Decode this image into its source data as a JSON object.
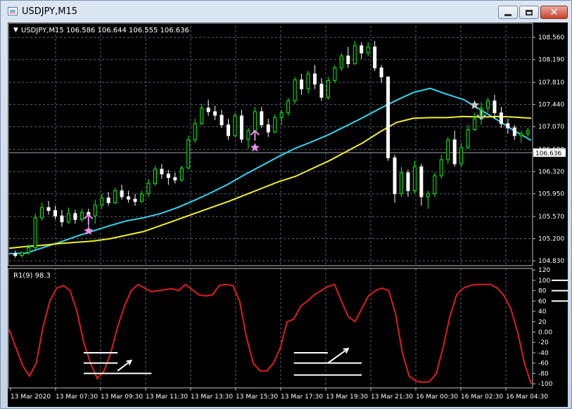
{
  "window": {
    "title": "USDJPY,M15"
  },
  "colors": {
    "background": "#000000",
    "axis": "#c0c0c0",
    "grid": "#5a6573",
    "bull": "#00ff00",
    "bear": "#ffffff",
    "ma_fast": "#2fd7f5",
    "ma_slow": "#f2ef2a",
    "rsi": "#e01c1c",
    "markers": "#e98be8",
    "star_grey": "#c8c8c8"
  },
  "icons": {
    "app": "mt4-chart-window-icon",
    "minimize": "minimize-icon",
    "maximize": "maximize-icon",
    "close": "close-icon"
  },
  "chart_data": [
    {
      "type": "candlestick",
      "title": "USDJPY,M15",
      "ohlc_label": "USDJPY,M15  106.586 106.644 106.555 106.636",
      "current_price_label": "106.636",
      "current_price": 106.636,
      "ylim": [
        104.75,
        108.75
      ],
      "ticks": [
        108.56,
        108.19,
        107.81,
        107.44,
        107.07,
        106.69,
        106.32,
        105.95,
        105.57,
        105.2,
        104.83
      ],
      "tick_labels": [
        "108.560",
        "108.190",
        "107.810",
        "107.440",
        "107.070",
        "106.690",
        "106.320",
        "105.950",
        "105.570",
        "105.200",
        "104.830"
      ],
      "grid": true,
      "series": [
        {
          "name": "ma_fast",
          "values": [
            104.95,
            104.96,
            105.05,
            105.14,
            105.24,
            105.33,
            105.42,
            105.5,
            105.55,
            105.62,
            105.72,
            105.84,
            105.97,
            106.11,
            106.27,
            106.42,
            106.57,
            106.71,
            106.82,
            106.94,
            107.08,
            107.22,
            107.37,
            107.51,
            107.64,
            107.71,
            107.61,
            107.52,
            107.35,
            107.18,
            107.0,
            106.84
          ]
        },
        {
          "name": "ma_slow",
          "values": [
            105.04,
            105.07,
            105.09,
            105.12,
            105.14,
            105.16,
            105.2,
            105.26,
            105.32,
            105.42,
            105.52,
            105.62,
            105.72,
            105.82,
            105.93,
            106.04,
            106.15,
            106.24,
            106.37,
            106.5,
            106.65,
            106.8,
            106.98,
            107.14,
            107.21,
            107.22,
            107.22,
            107.24,
            107.23,
            107.24,
            107.23,
            107.21
          ]
        }
      ],
      "candles": [
        [
          104.95,
          105.0,
          104.88,
          104.92
        ],
        [
          104.92,
          104.98,
          104.88,
          104.97
        ],
        [
          104.97,
          105.1,
          104.93,
          105.05
        ],
        [
          105.05,
          105.62,
          105.02,
          105.55
        ],
        [
          105.55,
          105.8,
          105.5,
          105.72
        ],
        [
          105.72,
          105.83,
          105.6,
          105.67
        ],
        [
          105.67,
          105.75,
          105.52,
          105.58
        ],
        [
          105.58,
          105.68,
          105.4,
          105.48
        ],
        [
          105.48,
          105.72,
          105.45,
          105.62
        ],
        [
          105.62,
          105.68,
          105.45,
          105.52
        ],
        [
          105.52,
          105.7,
          105.48,
          105.64
        ],
        [
          105.64,
          105.7,
          105.4,
          105.58
        ],
        [
          105.58,
          105.85,
          105.45,
          105.76
        ],
        [
          105.76,
          105.95,
          105.7,
          105.88
        ],
        [
          105.88,
          105.98,
          105.75,
          105.8
        ],
        [
          105.8,
          106.05,
          105.78,
          106.0
        ],
        [
          106.0,
          106.1,
          105.85,
          105.9
        ],
        [
          105.9,
          106.0,
          105.8,
          105.86
        ],
        [
          105.86,
          105.95,
          105.75,
          105.82
        ],
        [
          105.82,
          106.0,
          105.8,
          105.95
        ],
        [
          105.95,
          106.2,
          105.9,
          106.12
        ],
        [
          106.12,
          106.42,
          106.08,
          106.36
        ],
        [
          106.36,
          106.45,
          106.2,
          106.28
        ],
        [
          106.28,
          106.35,
          106.1,
          106.22
        ],
        [
          106.22,
          106.3,
          106.12,
          106.18
        ],
        [
          106.18,
          106.42,
          106.15,
          106.38
        ],
        [
          106.38,
          106.92,
          106.35,
          106.85
        ],
        [
          106.85,
          107.2,
          106.8,
          107.12
        ],
        [
          107.12,
          107.45,
          107.1,
          107.38
        ],
        [
          107.38,
          107.52,
          107.25,
          107.32
        ],
        [
          107.32,
          107.42,
          107.18,
          107.26
        ],
        [
          107.26,
          107.35,
          107.05,
          107.1
        ],
        [
          107.1,
          107.2,
          106.85,
          106.92
        ],
        [
          106.92,
          107.3,
          106.9,
          107.25
        ],
        [
          107.25,
          107.35,
          106.8,
          106.86
        ],
        [
          106.86,
          107.05,
          106.7,
          107.0
        ],
        [
          107.0,
          107.4,
          106.95,
          107.32
        ],
        [
          107.32,
          107.4,
          107.05,
          107.1
        ],
        [
          107.1,
          107.2,
          106.9,
          106.98
        ],
        [
          106.98,
          107.28,
          106.96,
          107.22
        ],
        [
          107.22,
          107.35,
          107.1,
          107.3
        ],
        [
          107.3,
          107.55,
          107.25,
          107.5
        ],
        [
          107.5,
          107.9,
          107.45,
          107.85
        ],
        [
          107.85,
          107.95,
          107.6,
          107.7
        ],
        [
          107.7,
          108.0,
          107.62,
          107.95
        ],
        [
          107.95,
          108.1,
          107.7,
          107.78
        ],
        [
          107.78,
          107.88,
          107.5,
          107.56
        ],
        [
          107.56,
          107.9,
          107.52,
          107.84
        ],
        [
          107.84,
          108.1,
          107.8,
          108.05
        ],
        [
          108.05,
          108.3,
          108.0,
          108.25
        ],
        [
          108.25,
          108.4,
          108.05,
          108.12
        ],
        [
          108.12,
          108.5,
          108.1,
          108.42
        ],
        [
          108.42,
          108.48,
          108.2,
          108.3
        ],
        [
          108.3,
          108.48,
          108.25,
          108.4
        ],
        [
          108.4,
          108.5,
          108.0,
          108.05
        ],
        [
          108.05,
          108.1,
          107.8,
          107.9
        ],
        [
          107.9,
          107.0,
          106.5,
          106.55
        ],
        [
          106.55,
          106.6,
          105.8,
          105.95
        ],
        [
          105.95,
          106.4,
          105.9,
          106.3
        ],
        [
          106.3,
          106.35,
          105.9,
          106.0
        ],
        [
          106.0,
          106.5,
          105.95,
          106.4
        ],
        [
          106.4,
          106.45,
          105.75,
          105.9
        ],
        [
          105.9,
          106.0,
          105.7,
          105.95
        ],
        [
          105.95,
          106.3,
          105.9,
          106.25
        ],
        [
          106.25,
          106.6,
          106.2,
          106.52
        ],
        [
          106.52,
          106.9,
          106.45,
          106.85
        ],
        [
          106.85,
          107.0,
          106.4,
          106.45
        ],
        [
          106.45,
          106.8,
          106.4,
          106.72
        ],
        [
          106.72,
          107.1,
          106.7,
          107.02
        ],
        [
          107.02,
          107.3,
          107.0,
          107.2
        ],
        [
          107.2,
          107.48,
          107.1,
          107.38
        ],
        [
          107.38,
          107.55,
          107.3,
          107.5
        ],
        [
          107.5,
          107.6,
          107.2,
          107.3
        ],
        [
          107.3,
          107.4,
          107.05,
          107.12
        ],
        [
          107.12,
          107.2,
          106.95,
          107.05
        ],
        [
          107.05,
          107.1,
          106.85,
          106.92
        ],
        [
          106.92,
          107.0,
          106.8,
          106.95
        ],
        [
          106.95,
          107.05,
          106.9,
          107.0
        ]
      ],
      "markers": [
        {
          "type": "star",
          "color": "pink",
          "index": 11,
          "price": 105.33
        },
        {
          "type": "arrow-up",
          "color": "pink",
          "index": 11,
          "price": 105.52
        },
        {
          "type": "star",
          "color": "pink",
          "index": 36,
          "price": 106.72
        },
        {
          "type": "arrow-up",
          "color": "pink",
          "index": 36,
          "price": 106.92
        },
        {
          "type": "star",
          "color": "grey",
          "index": 69,
          "price": 107.43
        },
        {
          "type": "arrow-down",
          "color": "grey",
          "index": 70,
          "price": 107.28
        }
      ]
    },
    {
      "type": "line",
      "title": "R1(9) 98.3",
      "ylim": [
        -108,
        123
      ],
      "ticks": [
        120,
        100,
        80,
        60,
        40,
        20,
        0.0,
        -20,
        -40,
        -60,
        -80,
        -100
      ],
      "tick_labels": [
        "120",
        "100",
        "80",
        "60",
        "40",
        "20",
        "0.00",
        "-20",
        "-40",
        "-60",
        "-80",
        "-100"
      ],
      "series": [
        {
          "name": "R1(9)",
          "values": [
            5,
            -30,
            -65,
            -85,
            -60,
            10,
            60,
            85,
            90,
            80,
            40,
            -20,
            -60,
            -90,
            -75,
            -40,
            10,
            50,
            80,
            92,
            85,
            78,
            80,
            82,
            84,
            80,
            92,
            82,
            72,
            70,
            72,
            90,
            92,
            90,
            60,
            -10,
            -60,
            -75,
            -75,
            -60,
            -30,
            20,
            25,
            50,
            60,
            72,
            80,
            88,
            92,
            60,
            30,
            20,
            45,
            70,
            80,
            85,
            80,
            35,
            -40,
            -85,
            -95,
            -97,
            -96,
            -80,
            -30,
            30,
            72,
            85,
            90,
            92,
            92,
            92,
            85,
            70,
            45,
            0,
            -60,
            -100
          ]
        }
      ],
      "annotations": [
        {
          "kind": "hline",
          "value": -40,
          "x_from": 11,
          "x_to": 16
        },
        {
          "kind": "hline",
          "value": -60,
          "x_from": 11,
          "x_to": 16
        },
        {
          "kind": "hline",
          "value": -80,
          "x_from": 11,
          "x_to": 21
        },
        {
          "kind": "arrow-up",
          "x_from": 16,
          "x_to": 18,
          "y_from": -75,
          "y_to": -55
        },
        {
          "kind": "hline",
          "value": -40,
          "x_from": 42,
          "x_to": 47
        },
        {
          "kind": "hline",
          "value": -60,
          "x_from": 42,
          "x_to": 52
        },
        {
          "kind": "hline",
          "value": -83,
          "x_from": 42,
          "x_to": 52
        },
        {
          "kind": "arrow-up",
          "x_from": 47,
          "x_to": 50,
          "y_from": -60,
          "y_to": -32
        },
        {
          "kind": "hline",
          "value": 100,
          "x_from": 80,
          "x_to": 95
        },
        {
          "kind": "hline",
          "value": 80,
          "x_from": 80,
          "x_to": 95
        },
        {
          "kind": "hline",
          "value": 60,
          "x_from": 80,
          "x_to": 91
        },
        {
          "kind": "arrow-down",
          "x_from": 91,
          "x_to": 94,
          "y_from": 95,
          "y_to": 60
        }
      ]
    }
  ],
  "time_axis": {
    "labels": [
      "13 Mar 2020",
      "13 Mar 07:30",
      "13 Mar 09:30",
      "13 Mar 11:30",
      "13 Mar 13:30",
      "13 Mar 15:30",
      "13 Mar 17:30",
      "13 Mar 19:30",
      "13 Mar 21:30",
      "16 Mar 00:30",
      "16 Mar 02:30",
      "16 Mar 04:30"
    ]
  }
}
